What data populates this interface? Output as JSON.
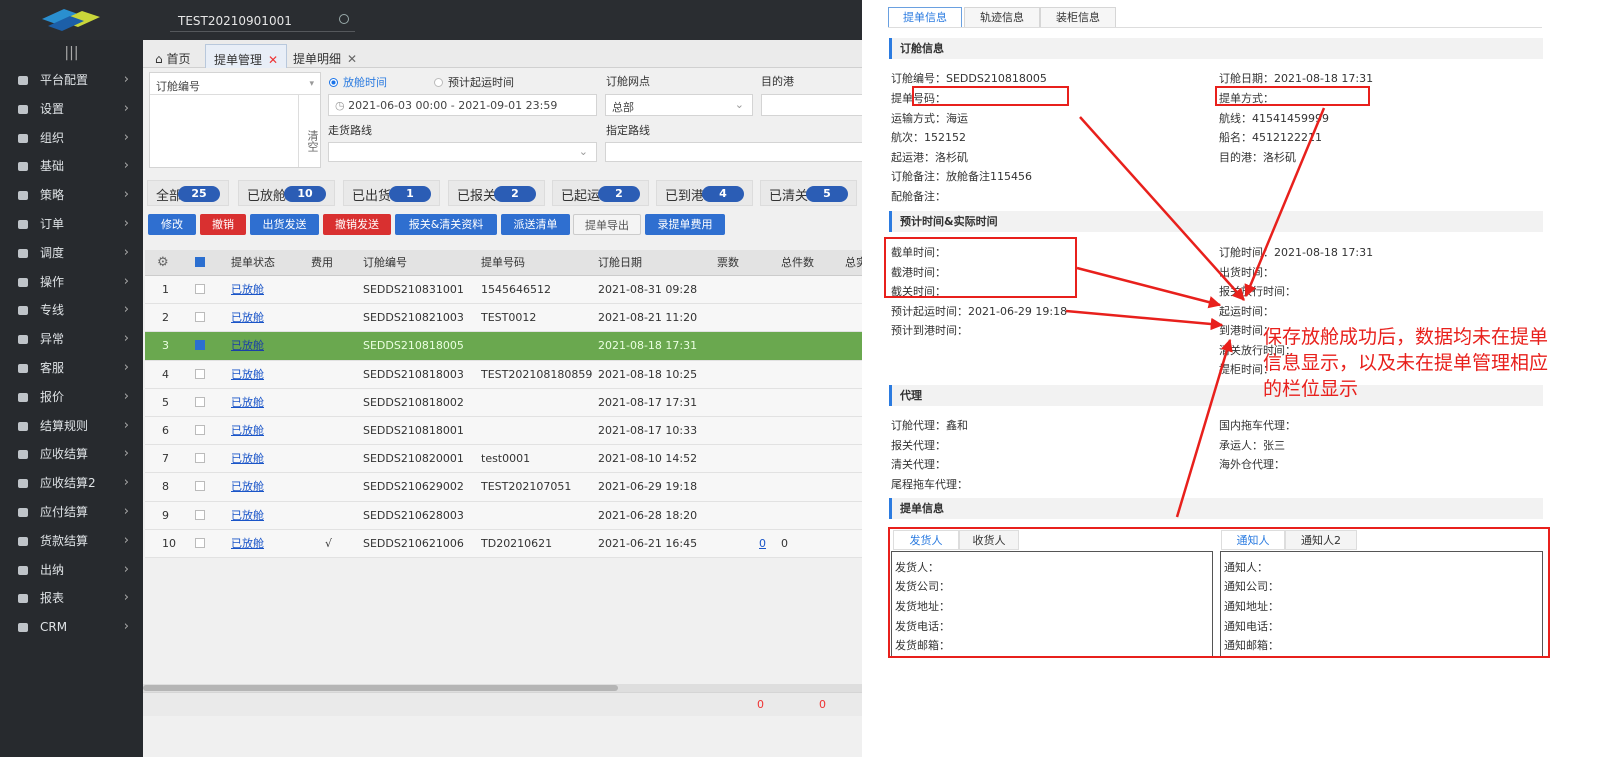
{
  "account": {
    "name": "TEST20210901001"
  },
  "sidebar": {
    "items": [
      {
        "label": "平台配置",
        "icon": "platform-config-icon"
      },
      {
        "label": "设置",
        "icon": "gear-icon"
      },
      {
        "label": "组织",
        "icon": "org-icon"
      },
      {
        "label": "基础",
        "icon": "layers-icon"
      },
      {
        "label": "策略",
        "icon": "strategy-icon"
      },
      {
        "label": "订单",
        "icon": "order-icon"
      },
      {
        "label": "调度",
        "icon": "dispatch-icon"
      },
      {
        "label": "操作",
        "icon": "hand-icon"
      },
      {
        "label": "专线",
        "icon": "route-icon"
      },
      {
        "label": "异常",
        "icon": "alert-icon"
      },
      {
        "label": "客服",
        "icon": "service-icon"
      },
      {
        "label": "报价",
        "icon": "quote-icon"
      },
      {
        "label": "结算规则",
        "icon": "rule-icon"
      },
      {
        "label": "应收结算",
        "icon": "receivable-icon"
      },
      {
        "label": "应收结算2",
        "icon": "receivable2-icon"
      },
      {
        "label": "应付结算",
        "icon": "payable-icon"
      },
      {
        "label": "货款结算",
        "icon": "payment-icon"
      },
      {
        "label": "出纳",
        "icon": "cashier-icon"
      },
      {
        "label": "报表",
        "icon": "report-icon"
      },
      {
        "label": "CRM",
        "icon": "crm-icon"
      }
    ]
  },
  "tabs": [
    {
      "label": "首页"
    },
    {
      "label": "提单管理"
    },
    {
      "label": "提单明细"
    }
  ],
  "filters": {
    "booking_no_label": "订舱编号",
    "clear_label": "清空",
    "radio_release_time": "放舱时间",
    "radio_est_departure": "预计起运时间",
    "date_range": "2021-06-03 00:00  -  2021-09-01 23:59",
    "booking_point_label": "订舱网点",
    "booking_point_value": "总部",
    "dest_port_label": "目的港",
    "route_label": "走货路线",
    "assigned_route_label": "指定路线"
  },
  "status_counts": [
    {
      "label": "全部",
      "count": "25"
    },
    {
      "label": "已放舱",
      "count": "10"
    },
    {
      "label": "已出货",
      "count": "1"
    },
    {
      "label": "已报关",
      "count": "2"
    },
    {
      "label": "已起运",
      "count": "2"
    },
    {
      "label": "已到港",
      "count": "4"
    },
    {
      "label": "已清关",
      "count": "5"
    }
  ],
  "actions": [
    {
      "label": "修改",
      "color": "#2f6fd0"
    },
    {
      "label": "撤销",
      "color": "#d93030"
    },
    {
      "label": "出货发送",
      "color": "#2f6fd0"
    },
    {
      "label": "撤销发送",
      "color": "#d93030"
    },
    {
      "label": "报关&清关资料",
      "color": "#2f6fd0"
    },
    {
      "label": "派送清单",
      "color": "#2f6fd0"
    },
    {
      "label": "提单导出",
      "color": "#f4f4f4"
    },
    {
      "label": "录提单费用",
      "color": "#2f6fd0"
    }
  ],
  "grid": {
    "columns": [
      "",
      "",
      "提单状态",
      "费用",
      "订舱编号",
      "提单号码",
      "订舱日期",
      "票数",
      "总件数",
      "总实"
    ],
    "rows": [
      {
        "n": "1",
        "status": "已放舱",
        "fee": "",
        "booking": "SEDDS210831001",
        "bl": "1545646512",
        "date": "2021-08-31 09:28",
        "tickets": "",
        "pieces": ""
      },
      {
        "n": "2",
        "status": "已放舱",
        "fee": "",
        "booking": "SEDDS210821003",
        "bl": "TEST0012",
        "date": "2021-08-21 11:20",
        "tickets": "",
        "pieces": ""
      },
      {
        "n": "3",
        "status": "已放舱",
        "fee": "",
        "booking": "SEDDS210818005",
        "bl": "",
        "date": "2021-08-18 17:31",
        "tickets": "",
        "pieces": ""
      },
      {
        "n": "4",
        "status": "已放舱",
        "fee": "",
        "booking": "SEDDS210818003",
        "bl": "TEST202108180859",
        "date": "2021-08-18 10:25",
        "tickets": "",
        "pieces": ""
      },
      {
        "n": "5",
        "status": "已放舱",
        "fee": "",
        "booking": "SEDDS210818002",
        "bl": "",
        "date": "2021-08-17 17:31",
        "tickets": "",
        "pieces": ""
      },
      {
        "n": "6",
        "status": "已放舱",
        "fee": "",
        "booking": "SEDDS210818001",
        "bl": "",
        "date": "2021-08-17 10:33",
        "tickets": "",
        "pieces": ""
      },
      {
        "n": "7",
        "status": "已放舱",
        "fee": "",
        "booking": "SEDDS210820001",
        "bl": "test0001",
        "date": "2021-08-10 14:52",
        "tickets": "",
        "pieces": ""
      },
      {
        "n": "8",
        "status": "已放舱",
        "fee": "",
        "booking": "SEDDS210629002",
        "bl": "TEST202107051",
        "date": "2021-06-29 19:18",
        "tickets": "",
        "pieces": ""
      },
      {
        "n": "9",
        "status": "已放舱",
        "fee": "",
        "booking": "SEDDS210628003",
        "bl": "",
        "date": "2021-06-28 18:20",
        "tickets": "",
        "pieces": ""
      },
      {
        "n": "10",
        "status": "已放舱",
        "fee": "√",
        "booking": "SEDDS210621006",
        "bl": "TD20210621",
        "date": "2021-06-21 16:45",
        "tickets": "0",
        "pieces": "0"
      }
    ],
    "footer_a": "0",
    "footer_b": "0"
  },
  "panel": {
    "tabs": [
      "提单信息",
      "轨迹信息",
      "装柜信息"
    ],
    "sec_booking": "订舱信息",
    "f_booking_no": "订舱编号：SEDDS210818005",
    "f_booking_date": "订舱日期：2021-08-18 17:31",
    "f_bl_no": "提单号码：",
    "f_bl_method": "提单方式：",
    "f_transport": "运输方式：海运",
    "f_route": "航线：41541459999",
    "f_voyage": "航次：152152",
    "f_vessel": "船名：4512122211",
    "f_pol": "起运港：洛杉矶",
    "f_pod": "目的港：洛杉矶",
    "f_remark": "订舱备注：放舱备注115456",
    "f_stowage_remark": "配舱备注：",
    "sec_time": "预计时间&实际时间",
    "f_cutoff_doc": "截单时间：",
    "f_cutoff_port": "截港时间：",
    "f_cutoff_customs": "截关时间：",
    "f_est_departure": "预计起运时间：2021-06-29 19:18",
    "f_est_arrival": "预计到港时间：",
    "f_book_date_r": "订舱时间：2021-08-18 17:31",
    "f_ship_time": "出货时间：",
    "f_declare_time": "报关放行时间：",
    "f_depart_time": "起运时间：",
    "f_arrive_time": "到港时间：",
    "f_clear_time": "清关放行时间：",
    "f_pick_time": "提柜时间：",
    "sec_agent": "代理",
    "f_book_agent": "订舱代理：鑫和",
    "f_declare_agent": "报关代理：",
    "f_clear_agent": "清关代理：",
    "f_tail_agent": "尾程拖车代理：",
    "f_dom_truck": "国内拖车代理：",
    "f_carrier": "承运人：张三",
    "f_overseas_wh": "海外仓代理：",
    "sec_bl": "提单信息",
    "shipper_tabs": [
      "发货人",
      "收货人"
    ],
    "notify_tabs": [
      "通知人",
      "通知人2"
    ],
    "shipper_fields": [
      "发货人：",
      "发货公司：",
      "发货地址：",
      "发货电话：",
      "发货邮箱："
    ],
    "notify_fields": [
      "通知人：",
      "通知公司：",
      "通知地址：",
      "通知电话：",
      "通知邮箱："
    ]
  },
  "annotation": {
    "note": "保存放舱成功后，数据均未在提单信息显示，以及未在提单管理相应的栏位显示",
    "color": "#e8201c"
  }
}
